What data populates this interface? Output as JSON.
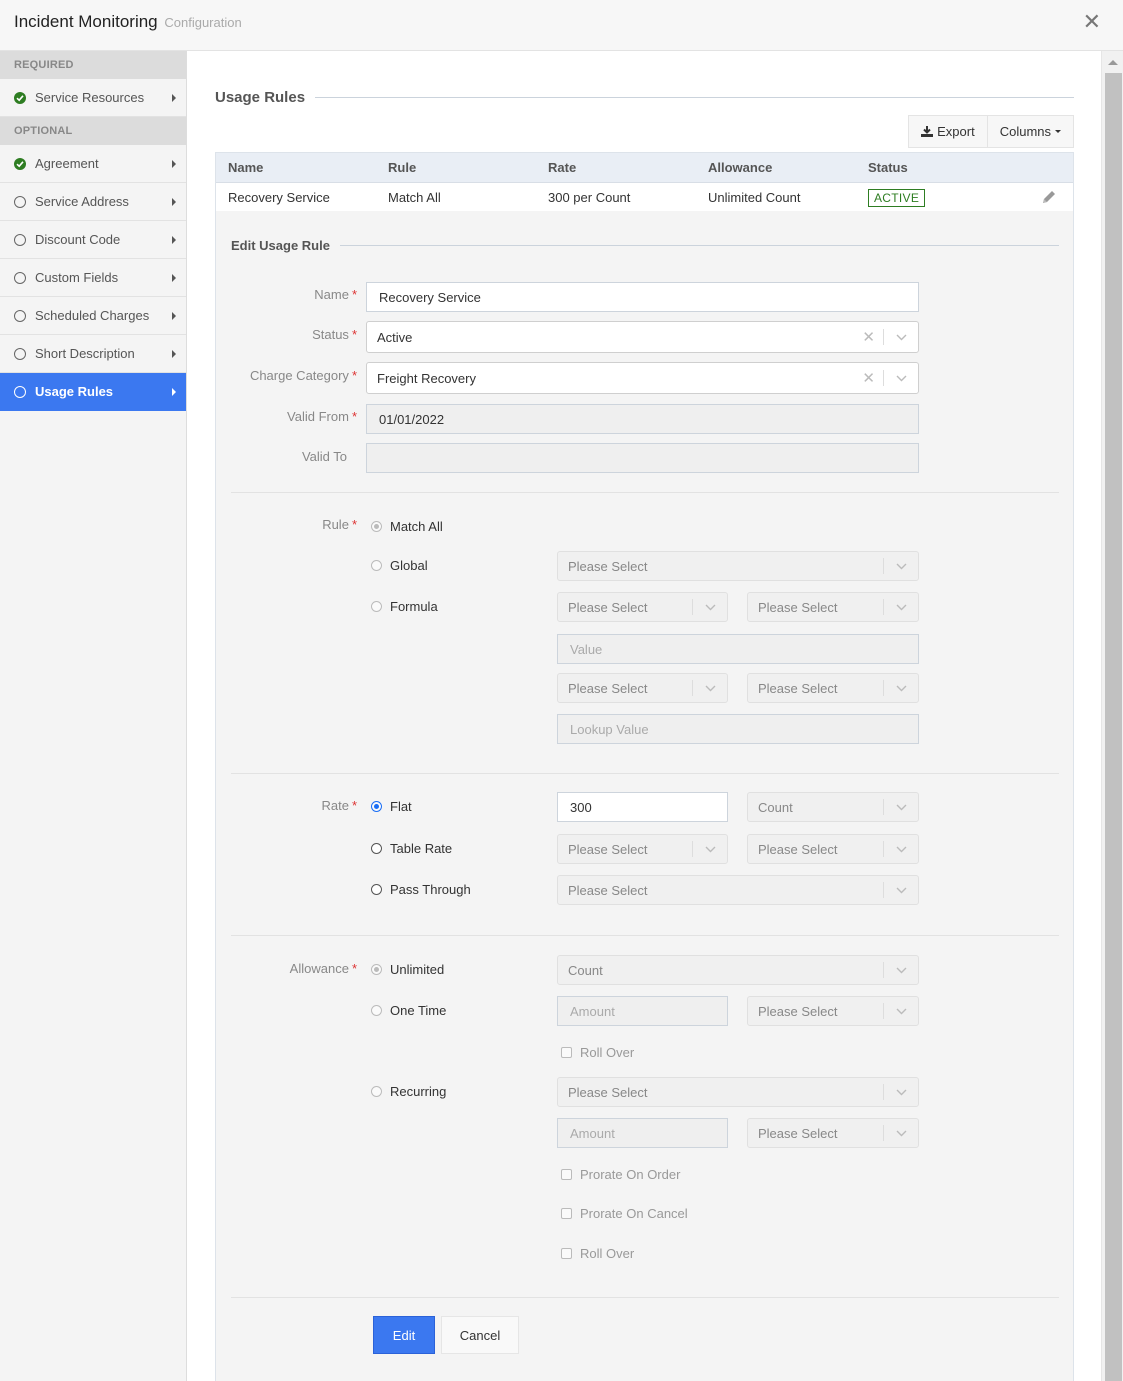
{
  "header": {
    "title": "Incident Monitoring",
    "subtitle": "Configuration",
    "close_icon": "close-icon"
  },
  "sidebar": {
    "required_label": "REQUIRED",
    "optional_label": "OPTIONAL",
    "required_items": [
      {
        "label": "Service Resources",
        "status": "complete",
        "icon": "check-circle-icon"
      }
    ],
    "optional_items": [
      {
        "label": "Agreement",
        "status": "complete",
        "icon": "check-circle-icon"
      },
      {
        "label": "Service Address",
        "status": "incomplete",
        "icon": "circle-icon"
      },
      {
        "label": "Discount Code",
        "status": "incomplete",
        "icon": "circle-icon"
      },
      {
        "label": "Custom Fields",
        "status": "incomplete",
        "icon": "circle-icon"
      },
      {
        "label": "Scheduled Charges",
        "status": "incomplete",
        "icon": "circle-icon"
      },
      {
        "label": "Short Description",
        "status": "incomplete",
        "icon": "circle-icon"
      },
      {
        "label": "Usage Rules",
        "status": "incomplete",
        "icon": "circle-icon",
        "active": true
      }
    ],
    "accent_color": "#3b78f0"
  },
  "main": {
    "section_title": "Usage Rules",
    "toolbar": {
      "export_label": "Export",
      "columns_label": "Columns"
    },
    "grid": {
      "columns": [
        "Name",
        "Rule",
        "Rate",
        "Allowance",
        "Status"
      ],
      "rows": [
        {
          "name": "Recovery Service",
          "rule": "Match All",
          "rate": "300 per Count",
          "allowance": "Unlimited Count",
          "status": "ACTIVE"
        }
      ],
      "status_color": "#2e7d22"
    },
    "edit": {
      "title": "Edit Usage Rule",
      "fields": {
        "name": {
          "label": "Name",
          "value": "Recovery Service",
          "required": true
        },
        "status": {
          "label": "Status",
          "value": "Active",
          "required": true
        },
        "charge_category": {
          "label": "Charge Category",
          "value": "Freight Recovery",
          "required": true
        },
        "valid_from": {
          "label": "Valid From",
          "value": "01/01/2022",
          "required": true
        },
        "valid_to": {
          "label": "Valid To",
          "value": "",
          "required": false
        }
      },
      "rule": {
        "label": "Rule",
        "options": [
          "Match All",
          "Global",
          "Formula"
        ],
        "selected": "Match All",
        "global_select": "Please Select",
        "formula_select_1": "Please Select",
        "formula_select_2": "Please Select",
        "value_placeholder": "Value",
        "formula_select_3": "Please Select",
        "formula_select_4": "Please Select",
        "lookup_placeholder": "Lookup Value"
      },
      "rate": {
        "label": "Rate",
        "options": [
          "Flat",
          "Table Rate",
          "Pass Through"
        ],
        "selected": "Flat",
        "flat_value": "300",
        "flat_unit": "Count",
        "table_select_1": "Please Select",
        "table_select_2": "Please Select",
        "pass_through_select": "Please Select"
      },
      "allowance": {
        "label": "Allowance",
        "options": [
          "Unlimited",
          "One Time",
          "Recurring"
        ],
        "selected": "Unlimited",
        "unlimited_unit": "Count",
        "one_time_amount_placeholder": "Amount",
        "one_time_select": "Please Select",
        "one_time_roll_over": "Roll Over",
        "recurring_select": "Please Select",
        "recurring_amount_placeholder": "Amount",
        "recurring_unit_select": "Please Select",
        "prorate_on_order": "Prorate On Order",
        "prorate_on_cancel": "Prorate On Cancel",
        "recurring_roll_over": "Roll Over"
      },
      "buttons": {
        "edit": "Edit",
        "cancel": "Cancel"
      }
    }
  }
}
